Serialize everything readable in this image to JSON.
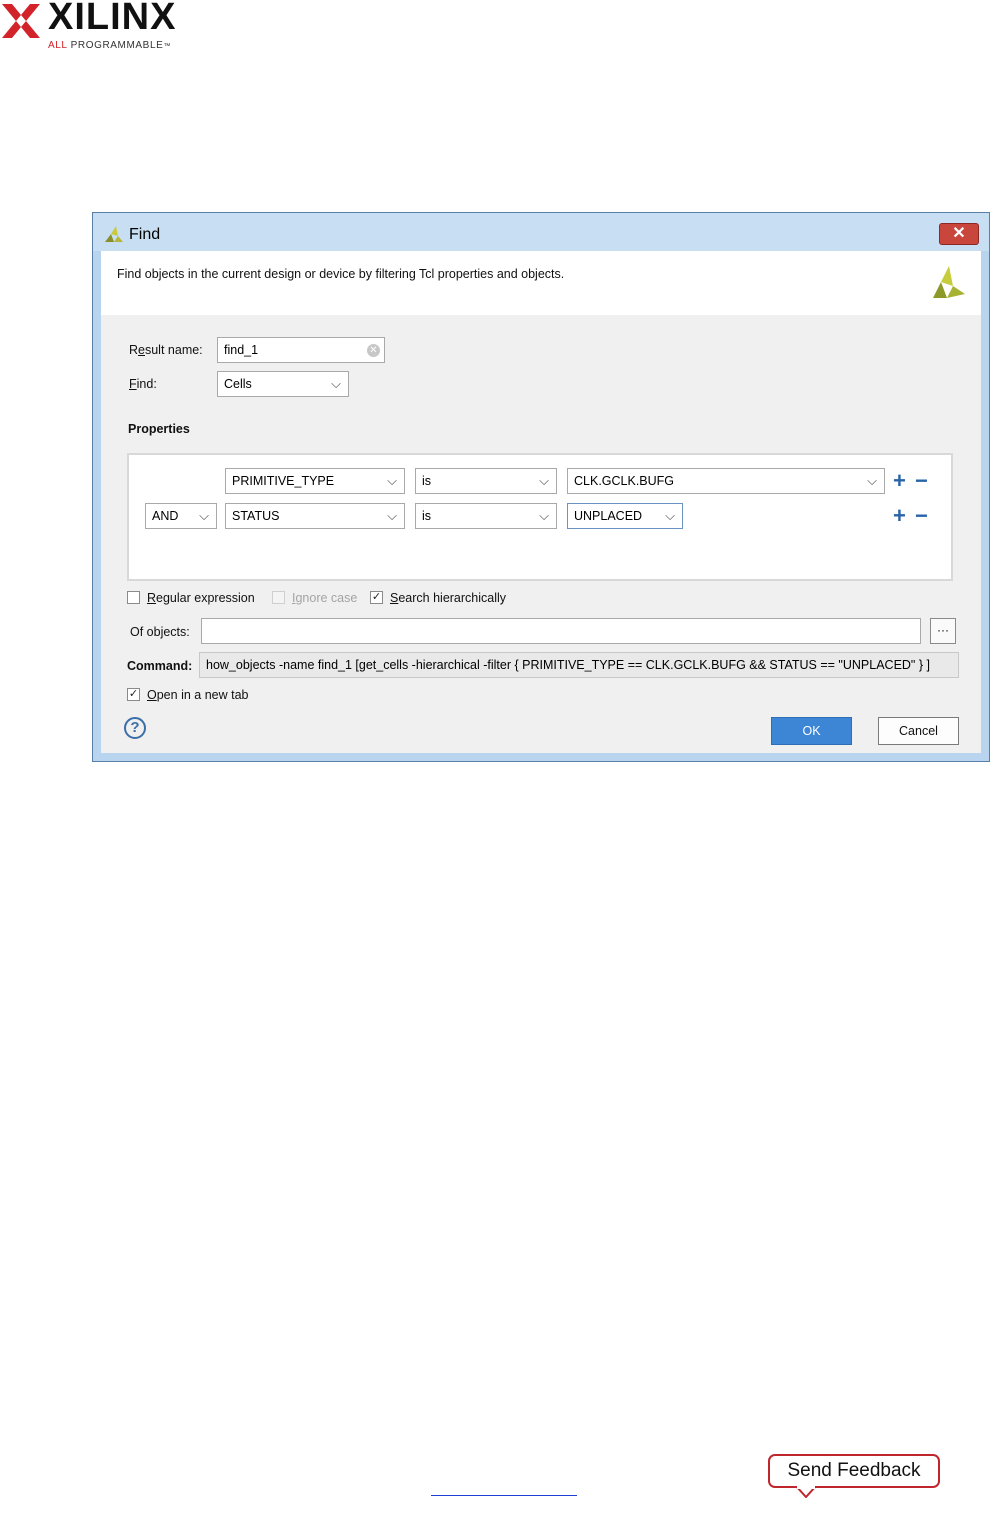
{
  "brand": {
    "name": "XILINX",
    "tagline_prefix": "ALL",
    "tagline_rest": " PROGRAMMABLE",
    "tagline_mark": "™"
  },
  "dialog": {
    "title": "Find",
    "close_glyph": "✕",
    "description": "Find objects in the current design or device by filtering Tcl properties and objects.",
    "result_name": {
      "label_prefix": "R",
      "label_underlined": "e",
      "label_rest": "sult name:",
      "value": "find_1"
    },
    "find": {
      "label_underlined": "F",
      "label_rest": "ind:",
      "value": "Cells"
    },
    "properties_heading": "Properties",
    "property_rows": [
      {
        "logic": "",
        "property": "PRIMITIVE_TYPE",
        "operator": "is",
        "value": "CLK.GCLK.BUFG"
      },
      {
        "logic": "AND",
        "property": "STATUS",
        "operator": "is",
        "value": "UNPLACED"
      }
    ],
    "plus_glyph": "+",
    "minus_glyph": "−",
    "options": {
      "regular_expression": {
        "u": "R",
        "rest": "egular expression",
        "checked": false
      },
      "ignore_case": {
        "u": "I",
        "rest": "gnore case",
        "checked": false,
        "disabled": true
      },
      "search_hierarchically": {
        "u": "S",
        "rest": "earch hierarchically",
        "checked": true
      }
    },
    "of_objects": {
      "label_pre": "Of ob",
      "label_u": "j",
      "label_rest": "ects:",
      "value": "",
      "browse_glyph": "···"
    },
    "command": {
      "label": "Command:",
      "value": "how_objects -name find_1 [get_cells -hierarchical -filter { PRIMITIVE_TYPE == CLK.GCLK.BUFG && STATUS == \"UNPLACED\" } ]"
    },
    "open_in_new_tab": {
      "u": "O",
      "rest": "pen in a new tab",
      "checked": true
    },
    "check_glyph": "✓",
    "help_glyph": "?",
    "ok_label": "OK",
    "cancel_label": "Cancel"
  },
  "footer": {
    "send_feedback": "Send Feedback"
  },
  "colors": {
    "brand_red": "#d2232a",
    "ok_blue": "#3d86d6",
    "dialog_border": "#b9d4ee",
    "feedback_border": "#c0272d"
  },
  "icons": [
    "xilinx-logo-icon",
    "vivado-icon",
    "close-icon",
    "chevron-down-icon",
    "plus-icon",
    "minus-icon",
    "help-icon",
    "clear-icon",
    "browse-icon",
    "checkmark-icon"
  ]
}
